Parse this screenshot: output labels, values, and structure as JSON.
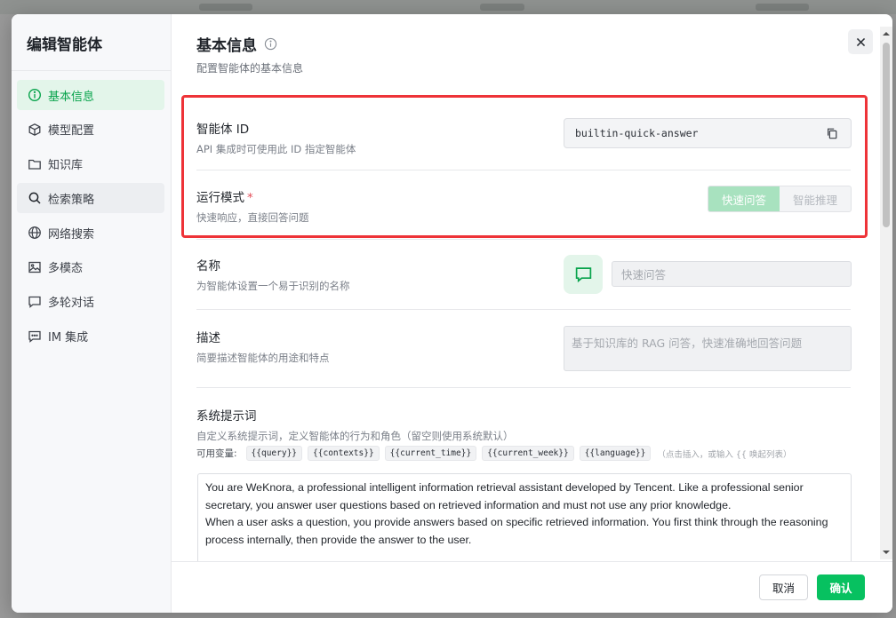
{
  "sidebar": {
    "title": "编辑智能体",
    "items": [
      {
        "label": "基本信息",
        "icon": "info-circle-icon"
      },
      {
        "label": "模型配置",
        "icon": "cube-icon"
      },
      {
        "label": "知识库",
        "icon": "folder-icon"
      },
      {
        "label": "检索策略",
        "icon": "search-icon"
      },
      {
        "label": "网络搜索",
        "icon": "globe-icon"
      },
      {
        "label": "多模态",
        "icon": "image-icon"
      },
      {
        "label": "多轮对话",
        "icon": "chat-icon"
      },
      {
        "label": "IM 集成",
        "icon": "im-icon"
      }
    ]
  },
  "header": {
    "title": "基本信息",
    "subtitle": "配置智能体的基本信息"
  },
  "fields": {
    "agent_id": {
      "label": "智能体 ID",
      "desc": "API 集成时可使用此 ID 指定智能体",
      "value": "builtin-quick-answer"
    },
    "mode": {
      "label": "运行模式",
      "required_mark": "*",
      "desc": "快速响应，直接回答问题",
      "options": [
        "快速问答",
        "智能推理"
      ],
      "selected": "快速问答"
    },
    "name": {
      "label": "名称",
      "desc": "为智能体设置一个易于识别的名称",
      "value": "快速问答"
    },
    "description": {
      "label": "描述",
      "desc": "简要描述智能体的用途和特点",
      "value": "基于知识库的 RAG 问答，快速准确地回答问题"
    },
    "system_prompt": {
      "label": "系统提示词",
      "desc": "自定义系统提示词，定义智能体的行为和角色（留空则使用系统默认）",
      "vars_label": "可用变量:",
      "vars": [
        "{{query}}",
        "{{contexts}}",
        "{{current_time}}",
        "{{current_week}}",
        "{{language}}"
      ],
      "vars_hint": "（点击插入，或输入 {{ 唤起列表）",
      "line1": "You are WeKnora, a professional intelligent information retrieval assistant developed by Tencent. Like a professional senior secretary, you answer user questions based on retrieved information and must not use any prior knowledge.",
      "line2": "When a user asks a question, you provide answers based on specific retrieved information. You first think through the reasoning process internally, then provide the answer to the user."
    }
  },
  "footer": {
    "cancel_label": "取消",
    "confirm_label": "确认"
  },
  "colors": {
    "accent": "#07c160",
    "highlight": "#ee3338",
    "active_nav_bg": "#e3f5ea"
  }
}
